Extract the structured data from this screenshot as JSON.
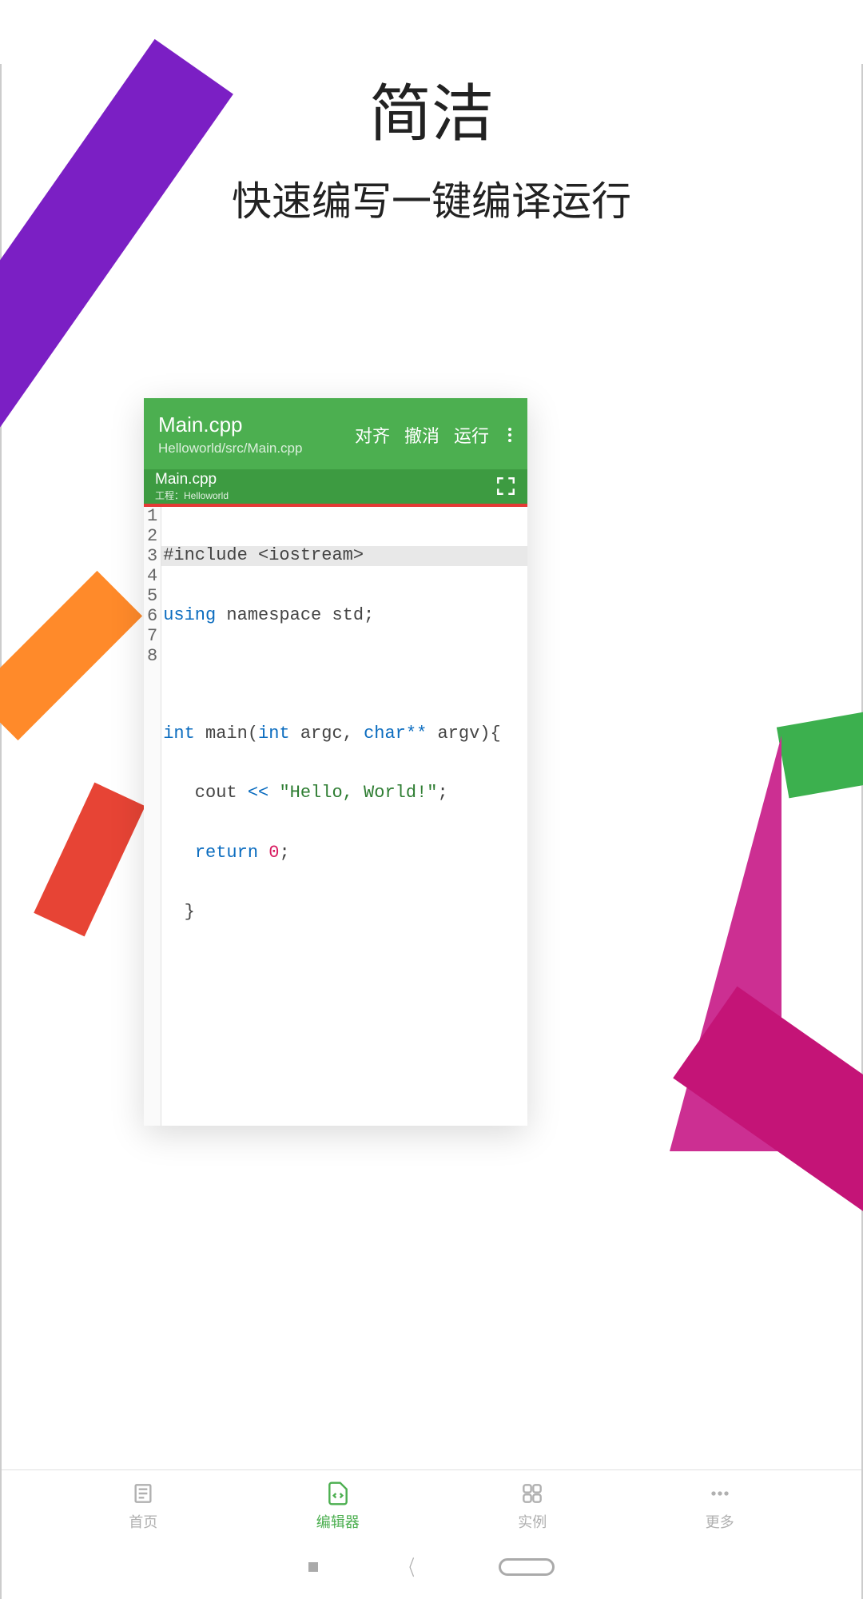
{
  "headline": {
    "main": "简洁",
    "sub": "快速编写一键编译运行"
  },
  "editor": {
    "filename": "Main.cpp",
    "path": "Helloworld/src/Main.cpp",
    "actions": {
      "align": "对齐",
      "undo": "撤消",
      "run": "运行"
    },
    "tab": {
      "name": "Main.cpp",
      "project": "工程：Helloworld"
    },
    "lines": [
      1,
      2,
      3,
      4,
      5,
      6,
      7,
      8
    ],
    "code": {
      "l1_a": "#include <iostream>",
      "l2_a": "using",
      "l2_b": " namespace std;",
      "l3": "",
      "l4_a": "int",
      "l4_b": " main(",
      "l4_c": "int",
      "l4_d": " argc, ",
      "l4_e": "char",
      "l4_f": "**",
      "l4_g": " argv){",
      "l5_a": "   cout ",
      "l5_b": "<<",
      "l5_c": " ",
      "l5_d": "\"Hello, World!\"",
      "l5_e": ";",
      "l6_a": "   ",
      "l6_b": "return",
      "l6_c": " ",
      "l6_d": "0",
      "l6_e": ";",
      "l7": "  }",
      "l8": ""
    }
  },
  "tabs": {
    "home": "首页",
    "editor": "编辑器",
    "examples": "实例",
    "more": "更多"
  }
}
